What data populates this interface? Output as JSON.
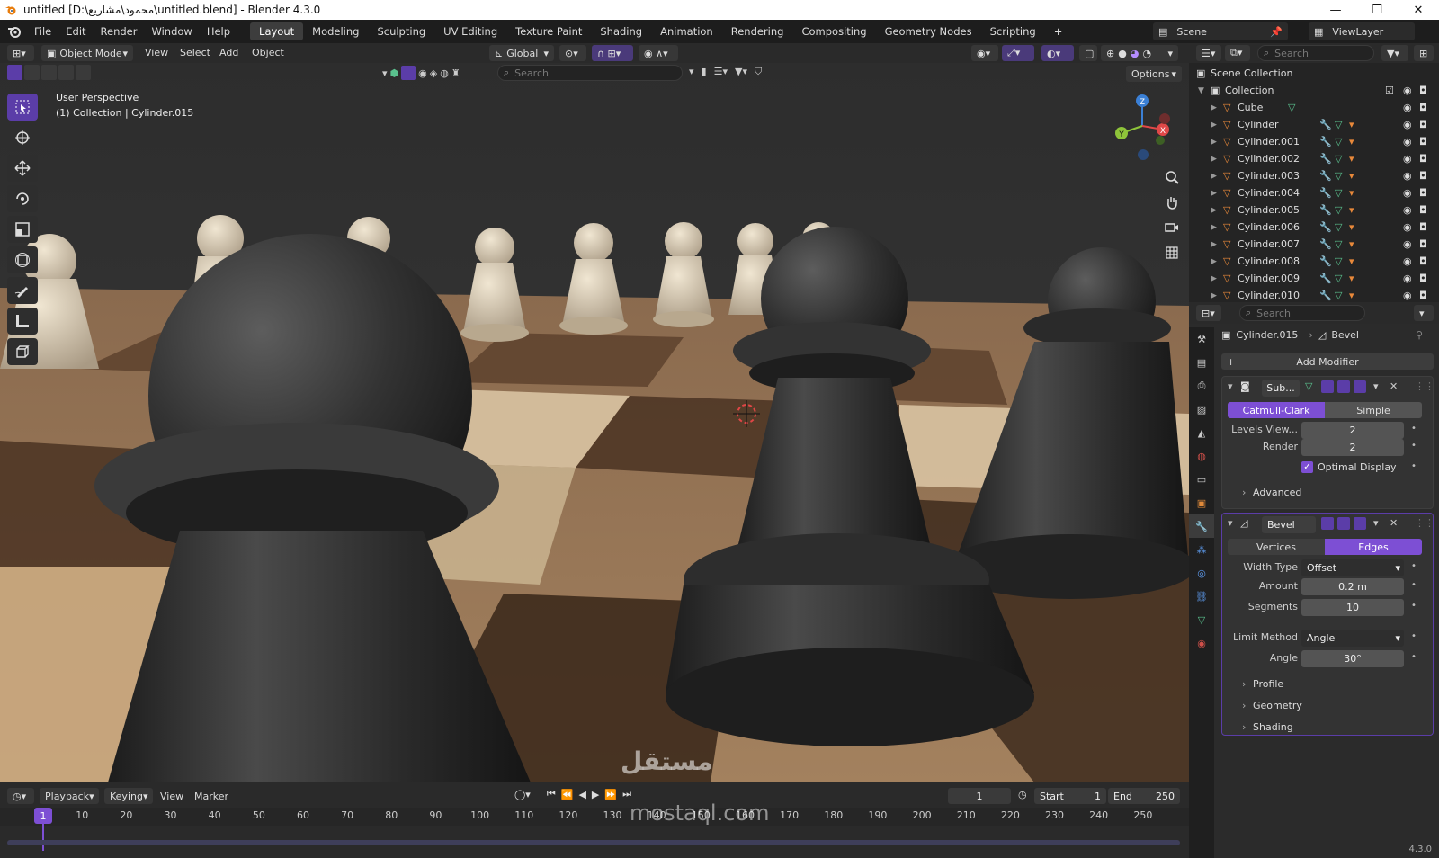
{
  "titlebar": {
    "title": "untitled [D:\\محمود\\مشاريع\\untitled.blend] - Blender 4.3.0",
    "minimize": "—",
    "maximize": "❐",
    "close": "✕"
  },
  "menu": {
    "items": [
      "File",
      "Edit",
      "Render",
      "Window",
      "Help"
    ]
  },
  "workspaces": [
    "Layout",
    "Modeling",
    "Sculpting",
    "UV Editing",
    "Texture Paint",
    "Shading",
    "Animation",
    "Rendering",
    "Compositing",
    "Geometry Nodes",
    "Scripting",
    "+"
  ],
  "scene": {
    "scene_name": "Scene",
    "viewlayer_name": "ViewLayer"
  },
  "viewport_header": {
    "mode": "Object Mode",
    "menus": [
      "View",
      "Select",
      "Add",
      "Object"
    ],
    "orientation": "Global",
    "search_placeholder": "Search",
    "options": "Options"
  },
  "viewport": {
    "perspective": "User Perspective",
    "collection_info": "(1) Collection | Cylinder.015",
    "gizmo_x": "X",
    "gizmo_y": "Y",
    "gizmo_z": "Z"
  },
  "outliner": {
    "search_placeholder": "Search",
    "root": "Scene Collection",
    "collection": "Collection",
    "items": [
      "Cube",
      "Cylinder",
      "Cylinder.001",
      "Cylinder.002",
      "Cylinder.003",
      "Cylinder.004",
      "Cylinder.005",
      "Cylinder.006",
      "Cylinder.007",
      "Cylinder.008",
      "Cylinder.009",
      "Cylinder.010"
    ]
  },
  "properties": {
    "search_placeholder": "Search",
    "object": "Cylinder.015",
    "modifier": "Bevel",
    "add_modifier": "Add Modifier",
    "subsurf": {
      "name": "Sub...",
      "mode_a": "Catmull-Clark",
      "mode_b": "Simple",
      "levels_label": "Levels View...",
      "levels": "2",
      "render_label": "Render",
      "render": "2",
      "optimal": "Optimal Display",
      "advanced": "Advanced"
    },
    "bevel": {
      "name": "Bevel",
      "vertices": "Vertices",
      "edges": "Edges",
      "width_type_label": "Width Type",
      "width_type": "Offset",
      "amount_label": "Amount",
      "amount": "0.2 m",
      "segments_label": "Segments",
      "segments": "10",
      "limit_label": "Limit Method",
      "limit": "Angle",
      "angle_label": "Angle",
      "angle": "30°",
      "profile": "Profile",
      "geometry": "Geometry",
      "shading": "Shading"
    }
  },
  "timeline": {
    "menus": [
      "Playback",
      "Keying",
      "View",
      "Marker"
    ],
    "current": "1",
    "start_label": "Start",
    "start": "1",
    "end_label": "End",
    "end": "250",
    "frame_marker": "1",
    "ticks": [
      "10",
      "20",
      "30",
      "40",
      "50",
      "60",
      "70",
      "80",
      "90",
      "100",
      "110",
      "120",
      "130",
      "140",
      "150",
      "160",
      "170",
      "180",
      "190",
      "200",
      "210",
      "220",
      "230",
      "240",
      "250"
    ]
  },
  "version": "4.3.0",
  "watermark": {
    "arabic": "مستقل",
    "latin": "mostaql.com"
  }
}
